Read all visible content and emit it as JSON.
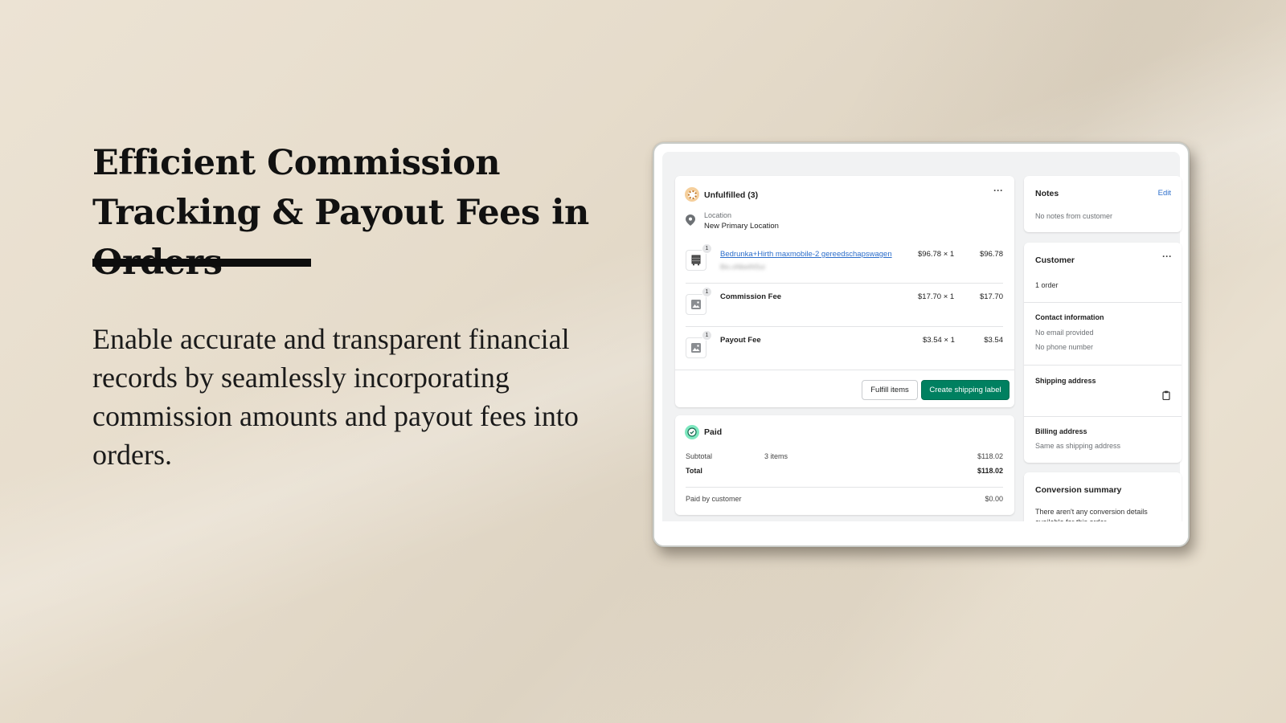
{
  "hero": {
    "title": "Efficient Commission Tracking & Payout Fees in Orders",
    "description": "Enable accurate and transparent financial records by seamlessly incorporating commission amounts and payout fees into orders."
  },
  "fulfillment": {
    "status": "Unfulfilled (3)",
    "menu_icon": "more-horizontal-icon",
    "location_label": "Location",
    "location_value": "New Primary Location",
    "items": [
      {
        "qty": "1",
        "name": "Bedrunka+Hirth maxmobile-2 gereedschapswagen",
        "sku": "Bio.oNbetNSui",
        "unit": "$96.78 × 1",
        "total": "$96.78",
        "is_link": true
      },
      {
        "qty": "1",
        "name": "Commission Fee",
        "unit": "$17.70 × 1",
        "total": "$17.70",
        "is_link": false
      },
      {
        "qty": "1",
        "name": "Payout Fee",
        "unit": "$3.54 × 1",
        "total": "$3.54",
        "is_link": false
      }
    ],
    "fulfill_button": "Fulfill items",
    "shipping_button": "Create shipping label"
  },
  "payment": {
    "status": "Paid",
    "subtotal_label": "Subtotal",
    "subtotal_items": "3 items",
    "subtotal_value": "$118.02",
    "total_label": "Total",
    "total_value": "$118.02",
    "paid_label": "Paid by customer",
    "paid_value": "$0.00"
  },
  "notes": {
    "title": "Notes",
    "edit": "Edit",
    "body": "No notes from customer"
  },
  "customer": {
    "title": "Customer",
    "orders": "1 order",
    "contact_title": "Contact information",
    "email": "No email provided",
    "phone": "No phone number",
    "shipping_title": "Shipping address",
    "billing_title": "Billing address",
    "billing_value": "Same as shipping address"
  },
  "conversion": {
    "title": "Conversion summary",
    "body": "There aren't any conversion details available for this order."
  },
  "colors": {
    "primary_button": "#008060",
    "link": "#2c6ecb",
    "unfulfilled_badge": "#f3c78d",
    "paid_badge": "#66e0b4"
  }
}
